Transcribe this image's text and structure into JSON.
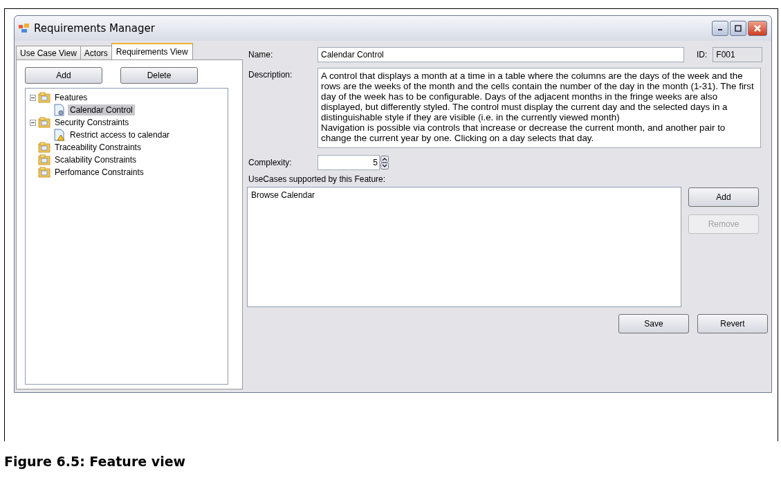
{
  "window": {
    "title": "Requirements Manager"
  },
  "tabs": [
    {
      "label": "Use Case View",
      "selected": false
    },
    {
      "label": "Actors",
      "selected": false
    },
    {
      "label": "Requirements View",
      "selected": true
    }
  ],
  "tree_buttons": [
    "Add",
    "Delete"
  ],
  "tree": [
    {
      "label": "Features",
      "kind": "folder",
      "expanded": true,
      "selected": false,
      "children": [
        {
          "label": "Calendar Control",
          "kind": "feature",
          "selected": true
        }
      ]
    },
    {
      "label": "Security Constraints",
      "kind": "folder",
      "expanded": true,
      "selected": false,
      "children": [
        {
          "label": "Restrict access to calendar",
          "kind": "constraint",
          "selected": false
        }
      ]
    },
    {
      "label": "Traceability Constraints",
      "kind": "folder",
      "selected": false
    },
    {
      "label": "Scalability Constraints",
      "kind": "folder",
      "selected": false
    },
    {
      "label": "Perfomance Constraints",
      "kind": "folder",
      "selected": false
    }
  ],
  "form": {
    "name_label": "Name:",
    "name_value": "Calendar Control",
    "id_label": "ID:",
    "id_value": "F001",
    "description_label": "Description:",
    "description": "A control that displays a month at a time in a table where the columns are the days of the week and the rows are the weeks of the month and the cells contain the number of the day in the month (1-31). The first day of the week has to be configurable. Days of the adjacent months in the fringe weeks are also displayed, but differently styled. The control must display the current day and the selected days in a distinguishable style if they are visible (i.e. in the currently viewed month)\nNavigation is possible via controls that increase or decrease the current month, and another pair to change the current year by one. Clicking on a day selects that day.",
    "complexity_label": "Complexity:",
    "complexity_value": "5",
    "usecases_label": "UseCases supported by this Feature:",
    "usecases": [
      {
        "label": "Browse Calendar",
        "selected": false
      }
    ]
  },
  "side_buttons": [
    {
      "label": "Add",
      "disabled": false
    },
    {
      "label": "Remove",
      "disabled": true
    }
  ],
  "footer_buttons": [
    "Save",
    "Revert"
  ],
  "caption": "Figure 6.5: Feature view"
}
